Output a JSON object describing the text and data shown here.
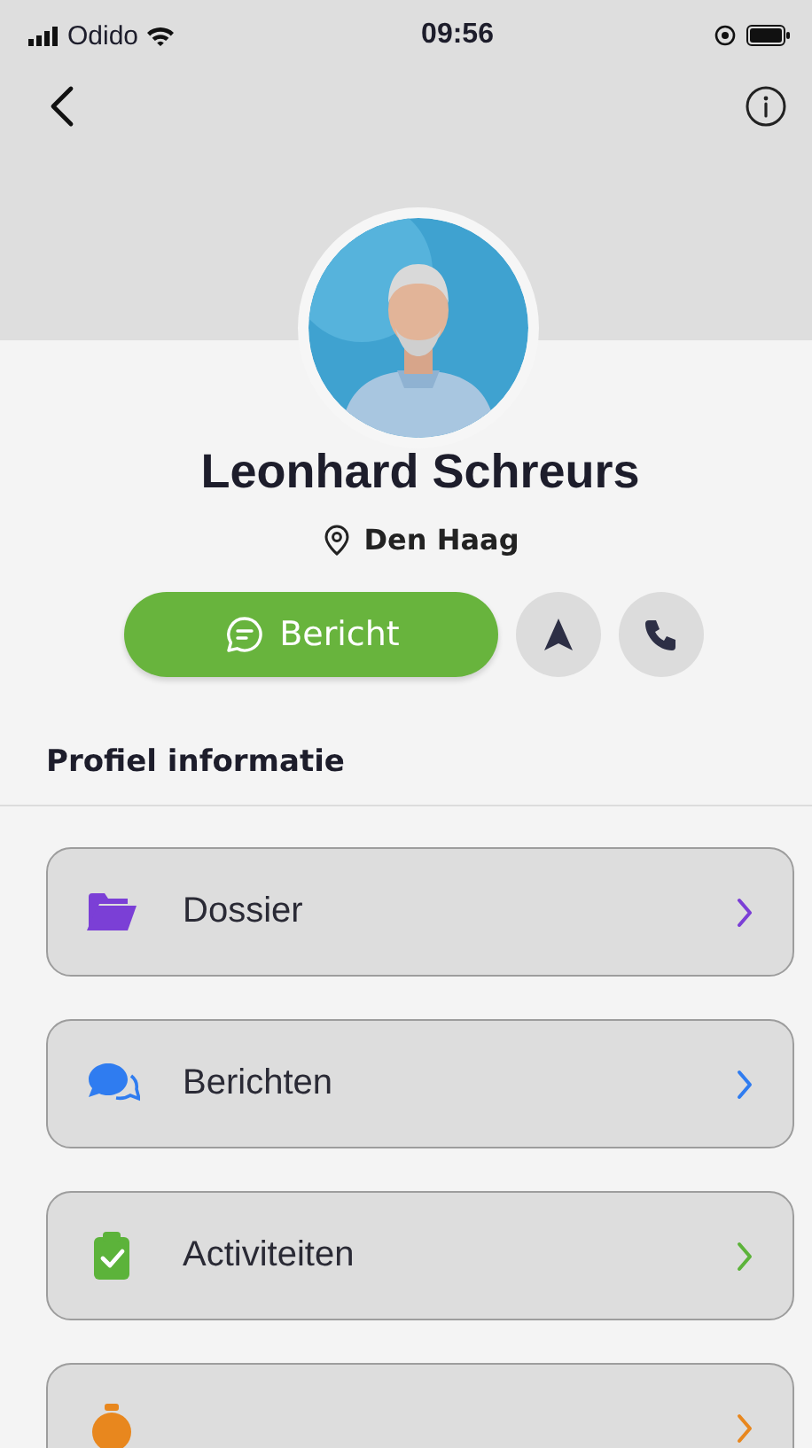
{
  "status_bar": {
    "carrier": "Odido",
    "time": "09:56"
  },
  "profile": {
    "name": "Leonhard Schreurs",
    "location": "Den Haag"
  },
  "actions": {
    "message_label": "Bericht"
  },
  "section_title": "Profiel informatie",
  "items": [
    {
      "kind": "folder",
      "label": "Dossier",
      "color": "#7b3fd6"
    },
    {
      "kind": "chat",
      "label": "Berichten",
      "color": "#2f7cf0"
    },
    {
      "kind": "clipboard",
      "label": "Activiteiten",
      "color": "#5cb33a"
    },
    {
      "kind": "timer",
      "color": "#e8871e"
    }
  ]
}
